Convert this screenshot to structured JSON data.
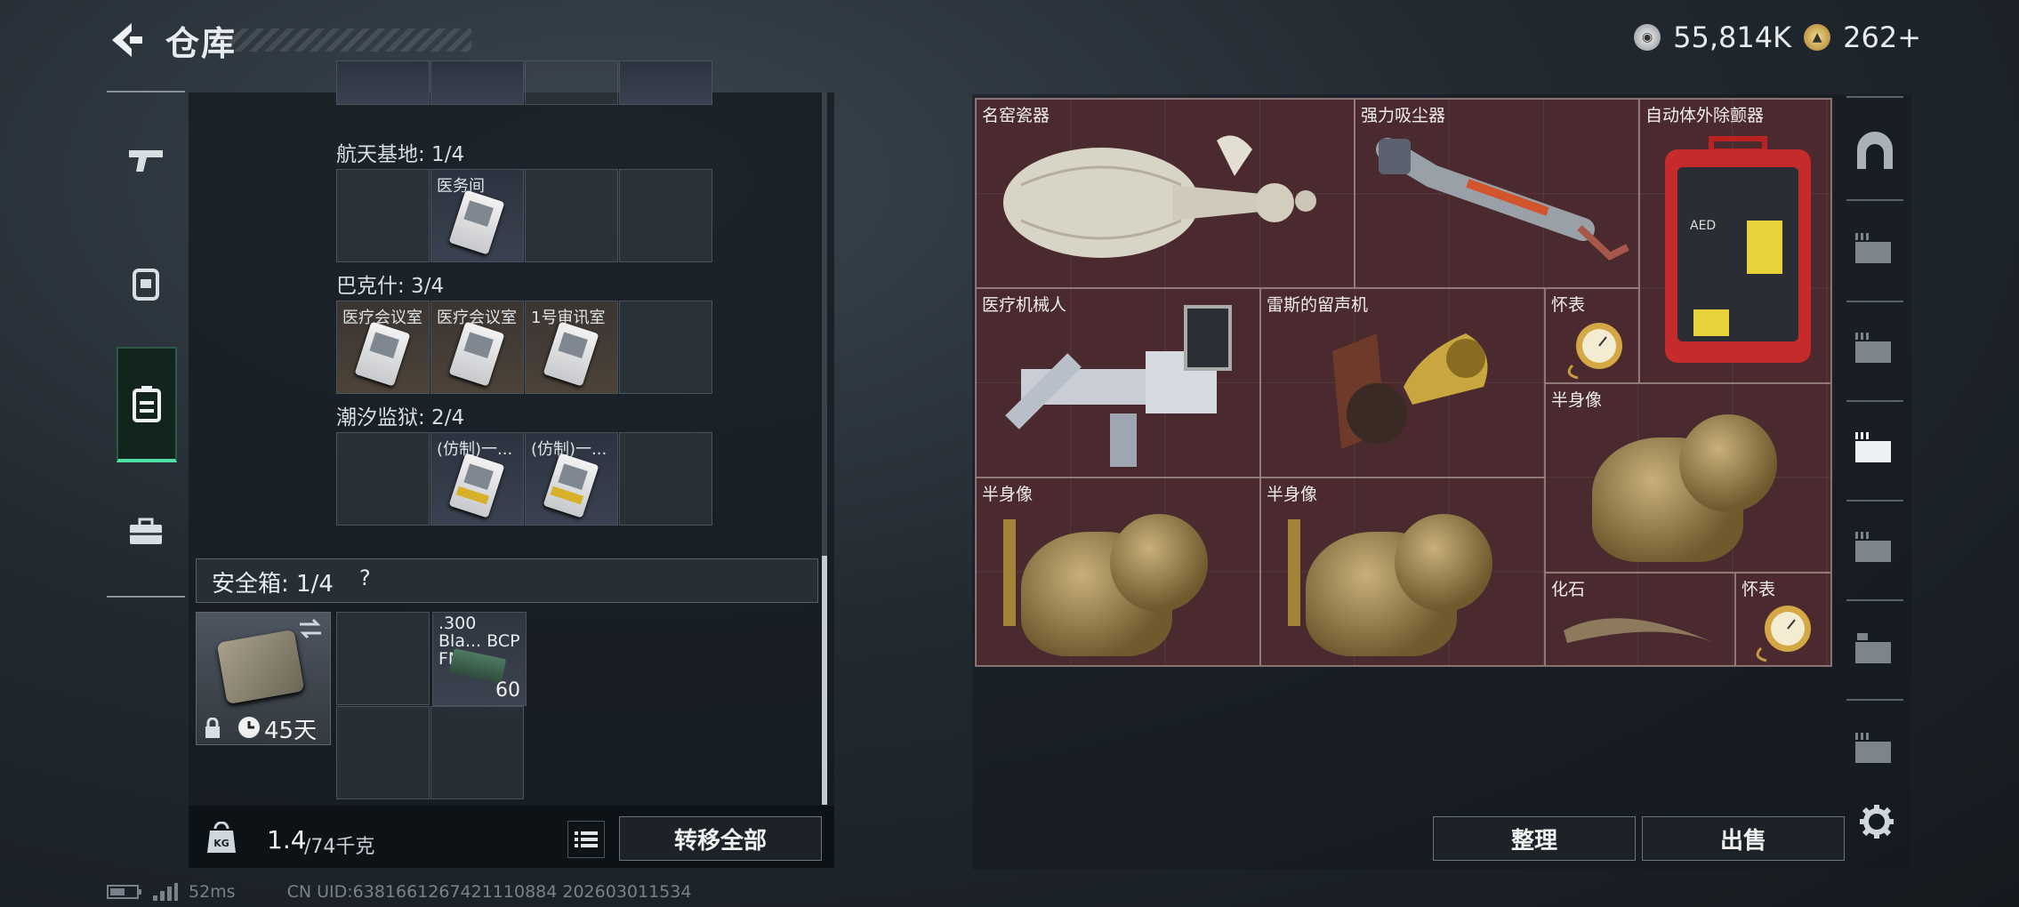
{
  "header": {
    "title": "仓库",
    "silver_amount": "55,814K",
    "gold_amount": "262+"
  },
  "left_panel": {
    "sections": [
      {
        "name": "航天基地: 1/4",
        "slots": [
          "",
          "医务间",
          "",
          ""
        ]
      },
      {
        "name": "巴克什: 3/4",
        "slots": [
          "医疗会议室",
          "医疗会议室",
          "1号审讯室",
          ""
        ]
      },
      {
        "name": "潮汐监狱: 2/4",
        "slots": [
          "",
          "(仿制)一...",
          "(仿制)一...",
          ""
        ]
      }
    ],
    "safe_box": {
      "label": "安全箱: 1/4",
      "help": "?",
      "days": "45天",
      "ammo_name": ".300 Bla... BCP FMJ",
      "ammo_count": "60"
    },
    "weight": {
      "current": "1.4",
      "max": "/74千克"
    },
    "transfer_all": "转移全部"
  },
  "stash": {
    "items": [
      "名窑瓷器",
      "强力吸尘器",
      "自动体外除颤器",
      "医疗机械人",
      "雷斯的留声机",
      "怀表",
      "半身像",
      "半身像",
      "半身像",
      "化石",
      "怀表"
    ],
    "sort_button": "整理",
    "sell_button": "出售"
  },
  "status_bar": {
    "ping": "52ms",
    "uid": "CN UID:6381661267421110884 202603011534"
  },
  "colors": {
    "accent_green": "#4fe0a4",
    "stash_bg": "#4a2a2e"
  }
}
